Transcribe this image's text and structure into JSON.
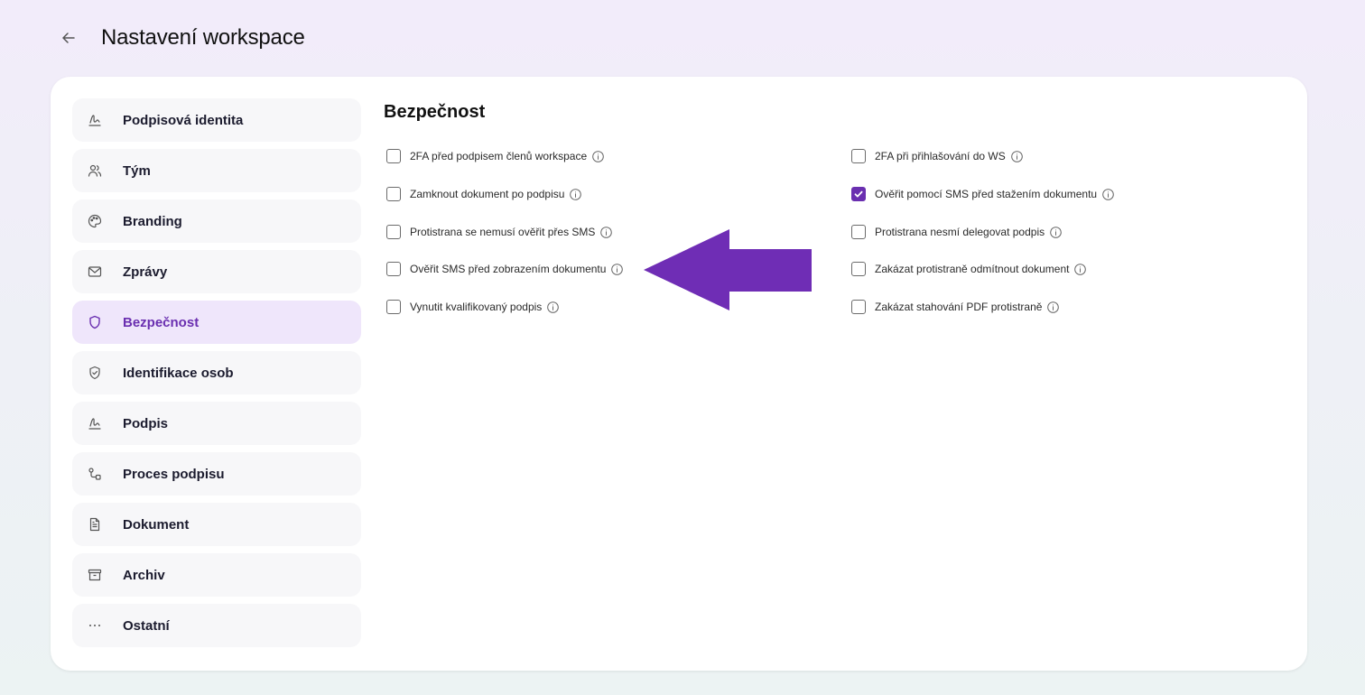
{
  "header": {
    "title": "Nastavení workspace"
  },
  "sidebar": {
    "items": [
      {
        "label": "Podpisová identita",
        "icon": "signature-icon"
      },
      {
        "label": "Tým",
        "icon": "users-icon"
      },
      {
        "label": "Branding",
        "icon": "palette-icon"
      },
      {
        "label": "Zprávy",
        "icon": "mail-icon"
      },
      {
        "label": "Bezpečnost",
        "icon": "shield-icon",
        "active": true
      },
      {
        "label": "Identifikace osob",
        "icon": "shield-check-icon"
      },
      {
        "label": "Podpis",
        "icon": "signature-icon"
      },
      {
        "label": "Proces podpisu",
        "icon": "workflow-icon"
      },
      {
        "label": "Dokument",
        "icon": "document-icon"
      },
      {
        "label": "Archiv",
        "icon": "archive-icon"
      },
      {
        "label": "Ostatní",
        "icon": "more-icon"
      }
    ]
  },
  "main": {
    "title": "Bezpečnost",
    "left_options": [
      {
        "label": "2FA před podpisem členů workspace",
        "checked": false
      },
      {
        "label": "Zamknout dokument po podpisu",
        "checked": false
      },
      {
        "label": "Protistrana se nemusí ověřit přes SMS",
        "checked": false
      },
      {
        "label": "Ověřit SMS před zobrazením dokumentu",
        "checked": false
      },
      {
        "label": "Vynutit kvalifikovaný podpis",
        "checked": false
      }
    ],
    "right_options": [
      {
        "label": "2FA při přihlašování do WS",
        "checked": false
      },
      {
        "label": "Ověřit pomocí SMS před stažením dokumentu",
        "checked": true
      },
      {
        "label": "Protistrana nesmí delegovat podpis",
        "checked": false
      },
      {
        "label": "Zakázat protistraně odmítnout dokument",
        "checked": false
      },
      {
        "label": "Zakázat stahování PDF protistraně",
        "checked": false
      }
    ]
  },
  "colors": {
    "accent": "#6a2fb0",
    "arrow": "#6f2db5",
    "active_bg": "#efe6fb"
  }
}
